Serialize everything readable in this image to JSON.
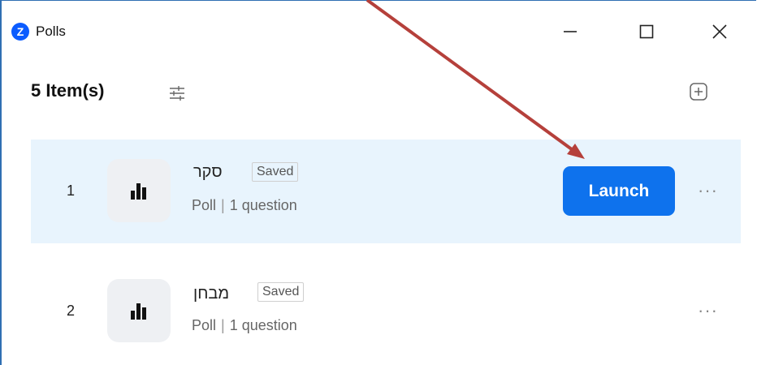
{
  "window": {
    "title": "Polls",
    "logo_letter": "Z"
  },
  "header": {
    "count_label": "5 Item(s)"
  },
  "polls": [
    {
      "number": "1",
      "name": "סקר",
      "status": "Saved",
      "type": "Poll",
      "questions": "1 question",
      "action_label": "Launch",
      "more": "···"
    },
    {
      "number": "2",
      "name": "מבחן",
      "status": "Saved",
      "type": "Poll",
      "questions": "1 question",
      "more": "···"
    }
  ],
  "colors": {
    "accent": "#0e72ed",
    "selected_row": "#e8f4fd",
    "annotation_arrow": "#b5403b"
  }
}
